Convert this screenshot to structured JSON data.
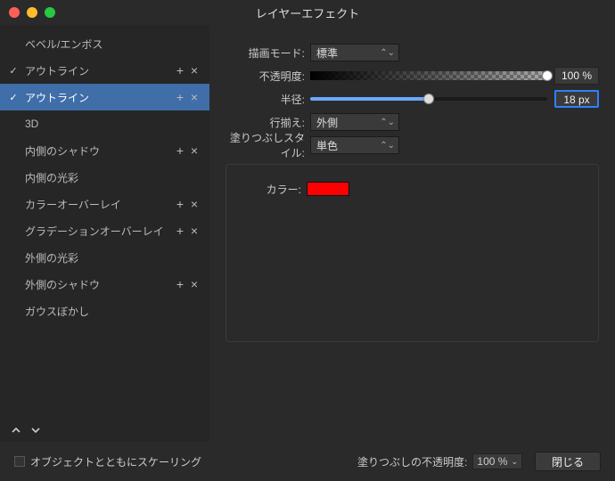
{
  "window": {
    "title": "レイヤーエフェクト"
  },
  "effects": [
    {
      "label": "ベベル/エンボス",
      "checked": false,
      "hasOps": false
    },
    {
      "label": "アウトライン",
      "checked": true,
      "hasOps": true
    },
    {
      "label": "アウトライン",
      "checked": true,
      "hasOps": true,
      "selected": true
    },
    {
      "label": "3D",
      "checked": false,
      "hasOps": false
    },
    {
      "label": "内側のシャドウ",
      "checked": false,
      "hasOps": true
    },
    {
      "label": "内側の光彩",
      "checked": false,
      "hasOps": false
    },
    {
      "label": "カラーオーバーレイ",
      "checked": false,
      "hasOps": true
    },
    {
      "label": "グラデーションオーバーレイ",
      "checked": false,
      "hasOps": true
    },
    {
      "label": "外側の光彩",
      "checked": false,
      "hasOps": false
    },
    {
      "label": "外側のシャドウ",
      "checked": false,
      "hasOps": true
    },
    {
      "label": "ガウスぼかし",
      "checked": false,
      "hasOps": false
    }
  ],
  "form": {
    "blendMode": {
      "label": "描画モード:",
      "value": "標準"
    },
    "opacity": {
      "label": "不透明度:",
      "value": "100 %",
      "percent": 100
    },
    "radius": {
      "label": "半径:",
      "value": "18 px",
      "percent": 50
    },
    "alignment": {
      "label": "行揃え:",
      "value": "外側"
    },
    "fillStyle": {
      "label": "塗りつぶしスタイル:",
      "value": "単色"
    },
    "color": {
      "label": "カラー:",
      "value": "#ff0000"
    }
  },
  "footer": {
    "scaleWithObject": "オブジェクトとともにスケーリング",
    "fillOpacityLabel": "塗りつぶしの不透明度:",
    "fillOpacityValue": "100 %",
    "close": "閉じる"
  }
}
